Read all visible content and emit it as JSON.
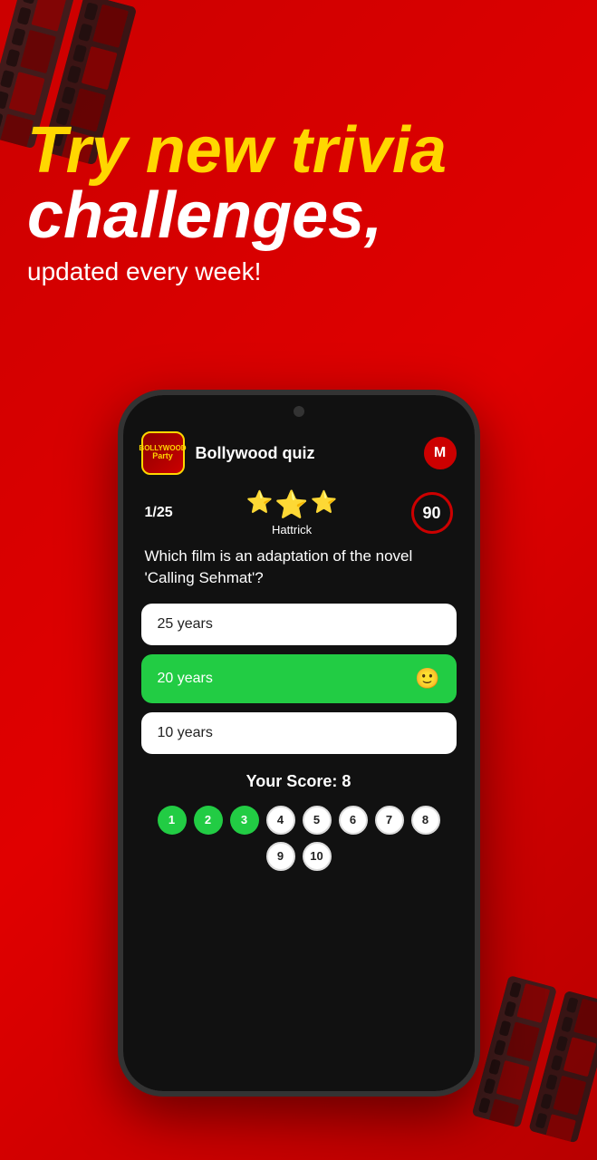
{
  "background": {
    "color": "#cc0000"
  },
  "hero": {
    "line1": "Try new trivia",
    "line2": "challenges,",
    "subtitle": "updated every week!"
  },
  "app": {
    "icon_text": "BOLLYWOOD\nParty",
    "title": "Bollywood quiz",
    "avatar_letter": "M"
  },
  "quiz": {
    "question_number": "1/25",
    "hattrick_label": "Hattrick",
    "timer_value": "90",
    "question_text": "Which film is an adaptation of the novel 'Calling Sehmat'?",
    "answers": [
      {
        "text": "25 years",
        "state": "white"
      },
      {
        "text": "20 years",
        "state": "correct",
        "emoji": "🙂"
      },
      {
        "text": "10 years",
        "state": "white"
      }
    ]
  },
  "score": {
    "label": "Your Score: 8"
  },
  "progress": {
    "dots": [
      {
        "num": "1",
        "active": true
      },
      {
        "num": "2",
        "active": true
      },
      {
        "num": "3",
        "active": true
      },
      {
        "num": "4",
        "active": false
      },
      {
        "num": "5",
        "active": false
      },
      {
        "num": "6",
        "active": false
      },
      {
        "num": "7",
        "active": false
      },
      {
        "num": "8",
        "active": false
      },
      {
        "num": "9",
        "active": false
      },
      {
        "num": "10",
        "active": false
      }
    ]
  }
}
